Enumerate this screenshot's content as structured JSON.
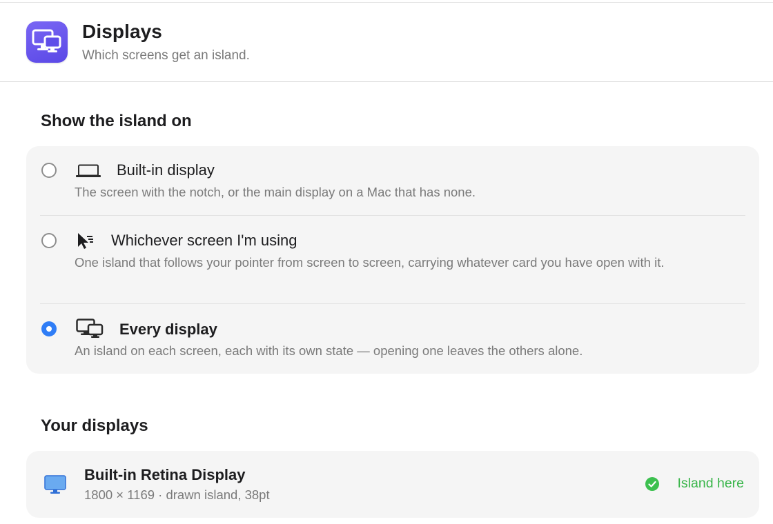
{
  "header": {
    "title": "Displays",
    "subtitle": "Which screens get an island.",
    "icon": "displays-icon",
    "accent_color": "#6a57ee"
  },
  "placement": {
    "section_title": "Show the island on",
    "options": [
      {
        "title": "Built-in display",
        "description": "The screen with the notch, or the main display on a Mac that has none.",
        "icon": "laptop-icon",
        "selected": false
      },
      {
        "title": "Whichever screen I'm using",
        "description": "One island that follows your pointer from screen to screen, carrying whatever card you have open with it.",
        "icon": "pointer-icon",
        "selected": false
      },
      {
        "title": "Every display",
        "description": "An island on each screen, each with its own state — opening one leaves the others alone.",
        "icon": "multiple-displays-icon",
        "selected": true
      }
    ],
    "selected_color": "#2f7df6"
  },
  "displays": {
    "section_title": "Your displays",
    "items": [
      {
        "name": "Built-in Retina Display",
        "info": "1800 × 1169 · drawn island, 38pt",
        "icon": "monitor-icon",
        "status": "Island here",
        "status_icon": "checkmark-circle-icon",
        "status_color": "#39b54a"
      }
    ]
  }
}
